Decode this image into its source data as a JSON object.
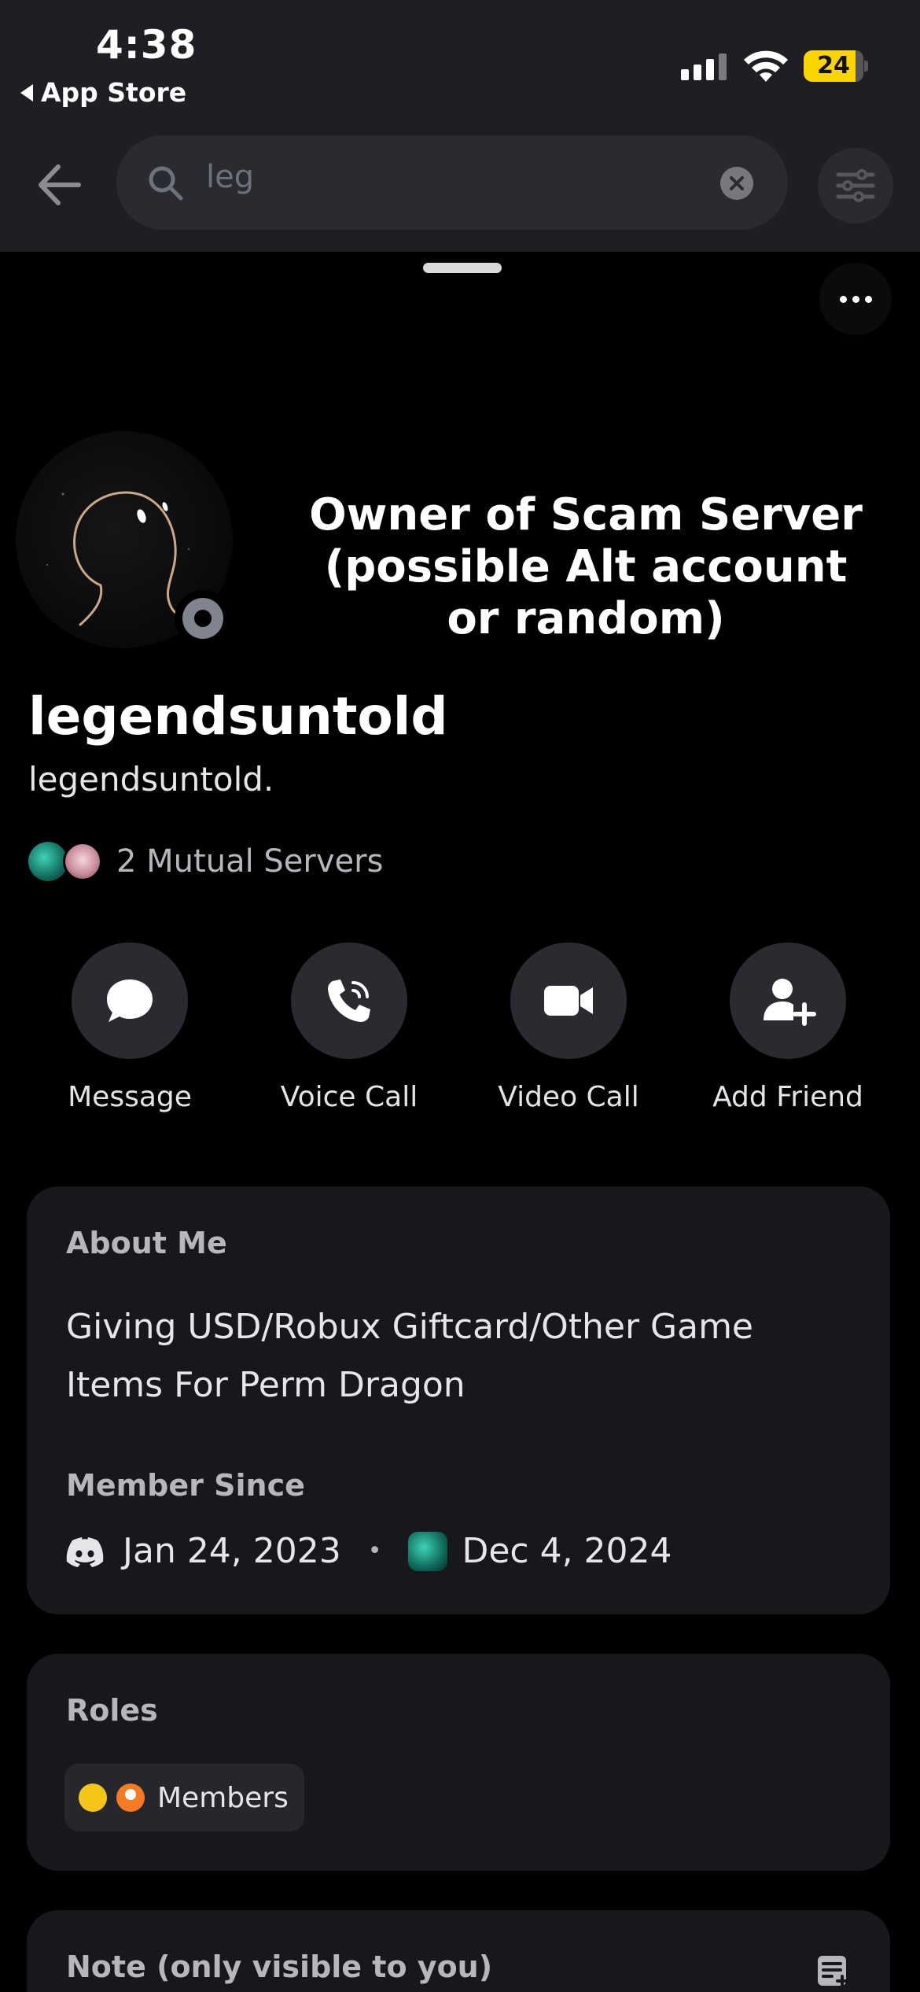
{
  "status_bar": {
    "time": "4:38",
    "back_app": "App Store",
    "battery": "24",
    "battery_color": "#fcd500"
  },
  "search": {
    "query": "leg",
    "icons": [
      "back-arrow-icon",
      "search-icon",
      "clear-icon",
      "filter-icon"
    ]
  },
  "overlay": {
    "caption": "Owner of Scam Server (possible Alt account or random)"
  },
  "profile": {
    "display_name": "legendsuntold",
    "username": "legendsuntold.",
    "mutual_servers": "2 Mutual Servers",
    "presence": "offline"
  },
  "actions": [
    {
      "label": "Message",
      "icon": "chat-bubble-icon"
    },
    {
      "label": "Voice Call",
      "icon": "phone-icon"
    },
    {
      "label": "Video Call",
      "icon": "video-camera-icon"
    },
    {
      "label": "Add Friend",
      "icon": "add-friend-icon"
    }
  ],
  "about": {
    "heading": "About Me",
    "bio": "Giving USD/Robux Giftcard/Other Game Items For Perm Dragon",
    "member_since_heading": "Member Since",
    "discord_since": "Jan 24, 2023",
    "separator": "•",
    "server_since": "Dec 4, 2024"
  },
  "roles": {
    "heading": "Roles",
    "items": [
      {
        "label": "Members",
        "colors": [
          "#f5c518",
          "#f57a23"
        ]
      }
    ]
  },
  "note": {
    "heading": "Note (only visible to you)"
  },
  "colors": {
    "background": "#000000",
    "header": "#1e1f24",
    "card": "#17181c",
    "button": "#2a2b31"
  }
}
